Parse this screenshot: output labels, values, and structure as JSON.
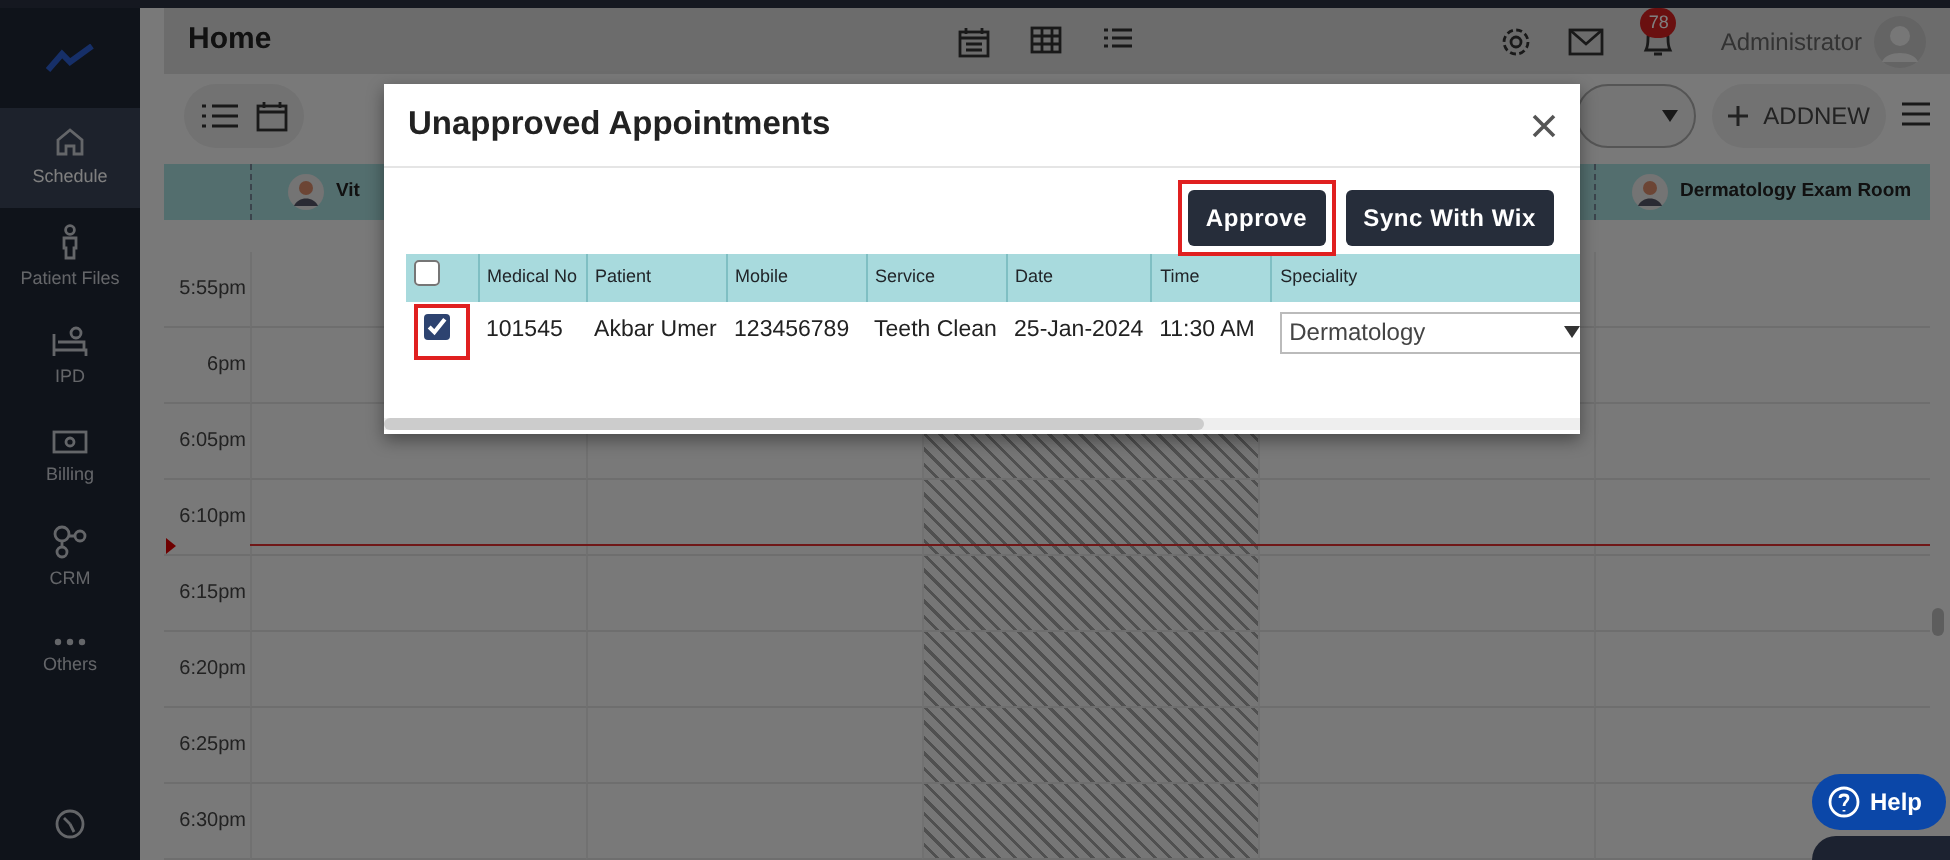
{
  "sidebar": {
    "items": [
      {
        "label": "Schedule",
        "selected": true
      },
      {
        "label": "Patient Files",
        "selected": false
      },
      {
        "label": "IPD",
        "selected": false
      },
      {
        "label": "Billing",
        "selected": false
      },
      {
        "label": "CRM",
        "selected": false
      },
      {
        "label": "Others",
        "selected": false
      }
    ]
  },
  "header": {
    "title": "Home",
    "notification_count": "78",
    "user": "Administrator"
  },
  "toolbar": {
    "add_button": "ADDNEW"
  },
  "calendar": {
    "columns": [
      {
        "label": "Vit",
        "blocked": false
      },
      {
        "blocked": false
      },
      {
        "blocked": true
      },
      {
        "blocked": false
      },
      {
        "label": "Dermatology Exam Room",
        "blocked": false
      }
    ],
    "times": [
      "5:55pm",
      "6pm",
      "6:05pm",
      "6:10pm",
      "6:15pm",
      "6:20pm",
      "6:25pm",
      "6:30pm"
    ]
  },
  "modal": {
    "title": "Unapproved Appointments",
    "buttons": [
      {
        "label": "Approve",
        "highlighted": true
      },
      {
        "label": "Sync With Wix",
        "highlighted": false
      }
    ],
    "table": {
      "select_all_checked": false,
      "columns": [
        "Medical No",
        "Patient",
        "Mobile",
        "Service",
        "Date",
        "Time",
        "Speciality"
      ],
      "rows": [
        {
          "checked": true,
          "highlighted": true,
          "medical_no": "101545",
          "patient": "Akbar Umer",
          "mobile": "123456789",
          "service": "Teeth Clean",
          "date": "25-Jan-2024",
          "time": "11:30 AM",
          "speciality": "Dermatology"
        }
      ]
    }
  },
  "help_button": "Help"
}
